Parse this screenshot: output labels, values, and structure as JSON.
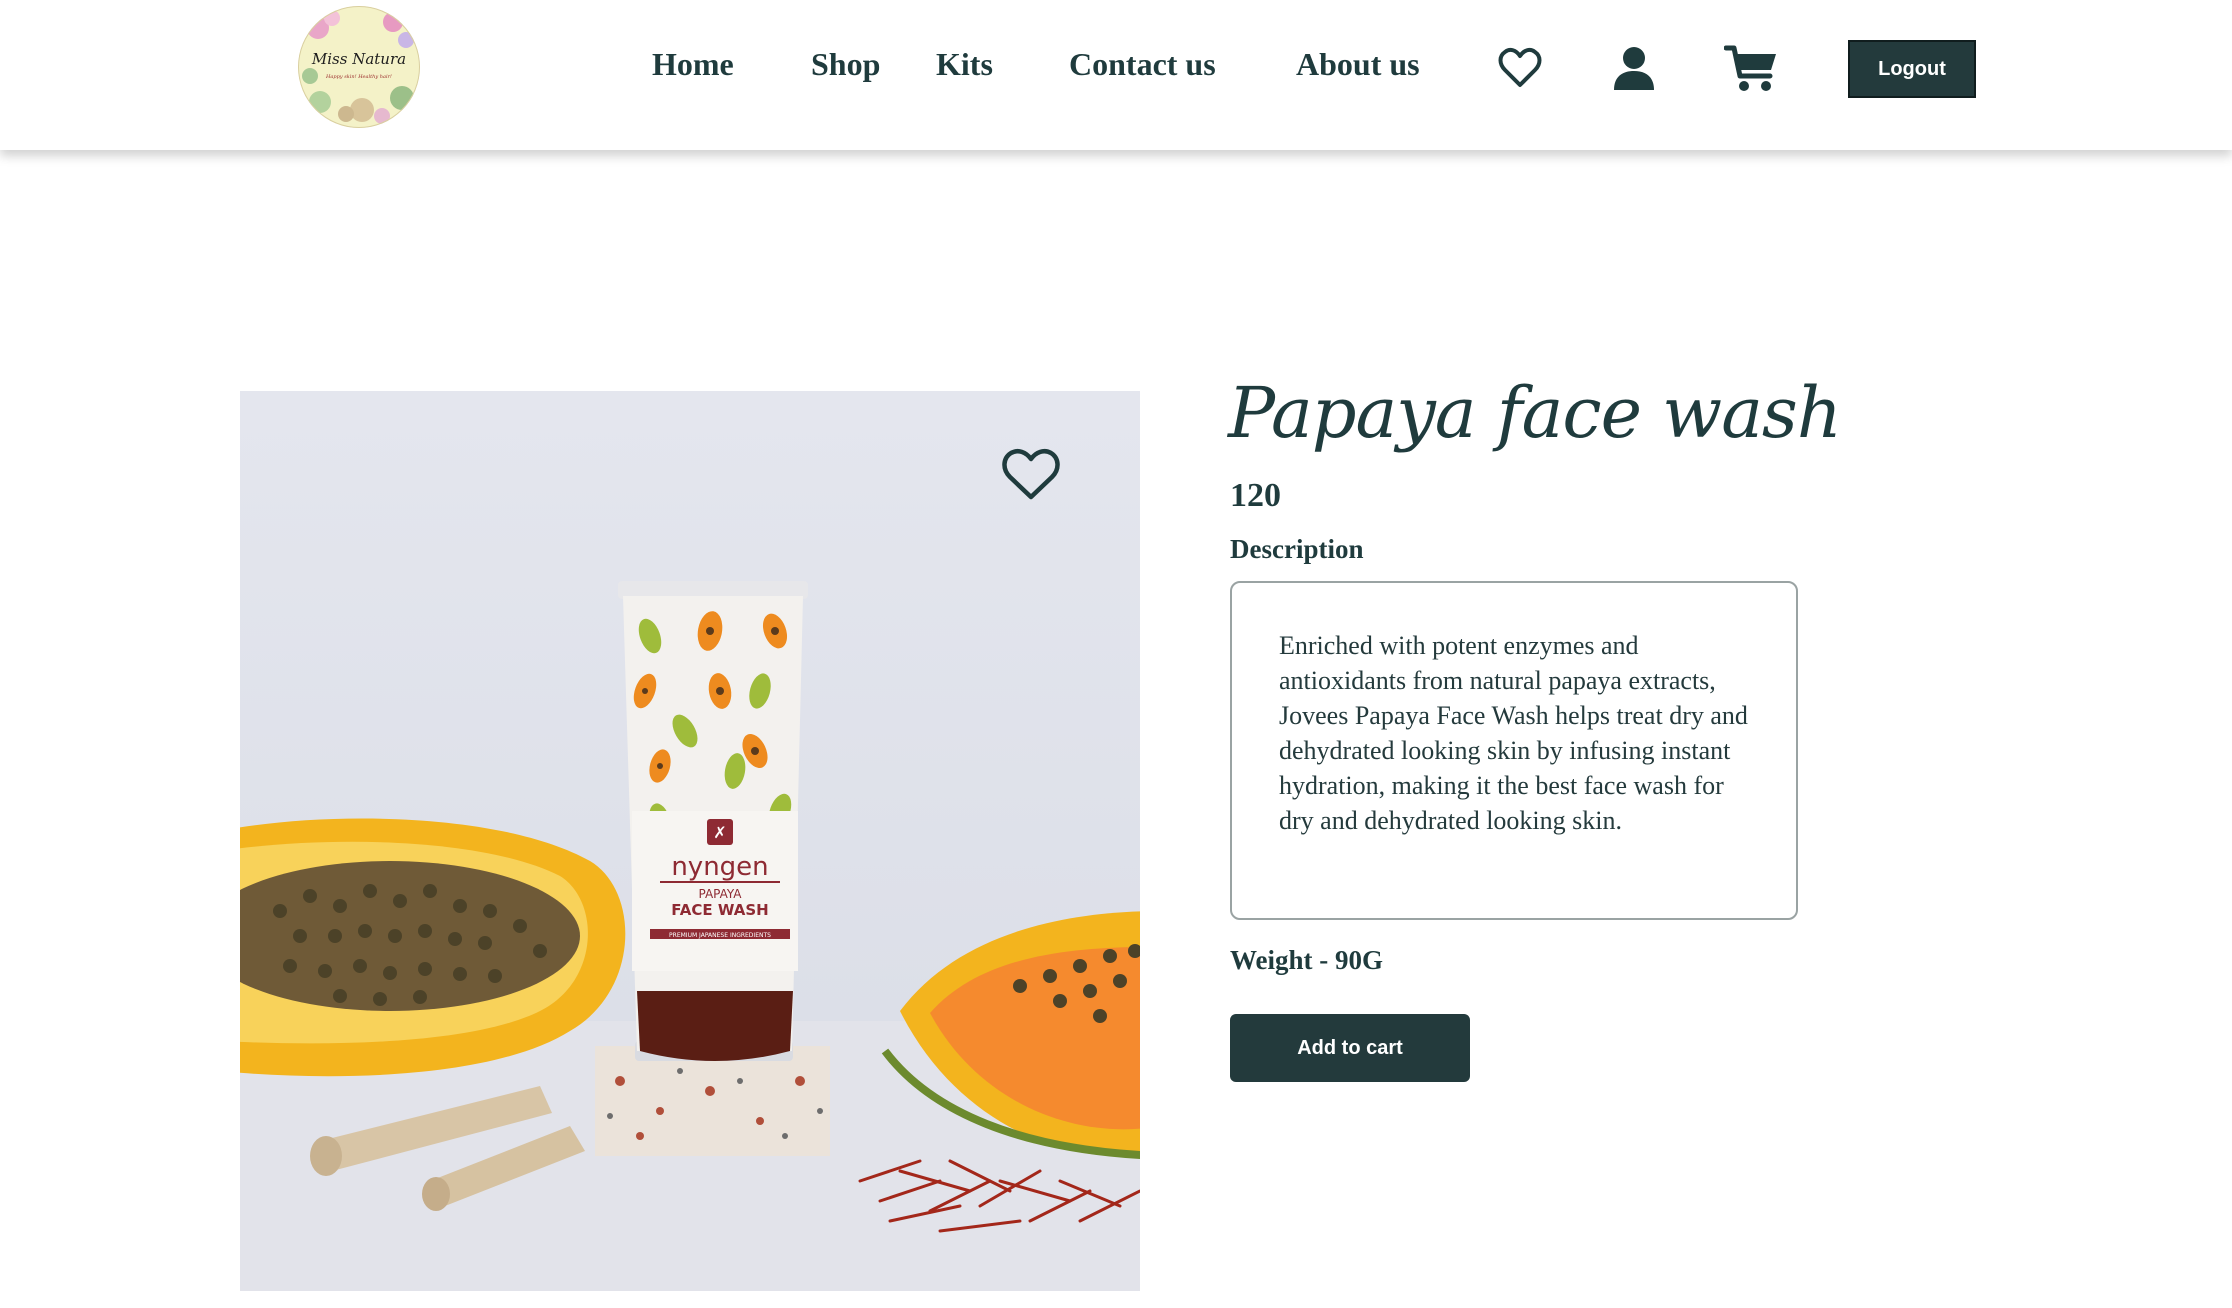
{
  "brand": {
    "logo_text": "Miss Natura",
    "logo_tagline": "Happy skin! Healthy hair!"
  },
  "nav": {
    "home": "Home",
    "shop": "Shop",
    "kits": "Kits",
    "contact": "Contact us",
    "about": "About us",
    "icons": [
      "heart-icon",
      "user-icon",
      "cart-icon"
    ],
    "logout": "Logout"
  },
  "product": {
    "name": "Papaya face wash",
    "price": "120",
    "description_label": "Description",
    "description": "Enriched with potent enzymes and antioxidants from natural papaya extracts, Jovees Papaya Face Wash helps treat dry and dehydrated looking skin by infusing instant hydration, making it the best face wash for dry and dehydrated looking skin.",
    "weight": "Weight - 90G",
    "add_to_cart": "Add to cart",
    "image": {
      "brand": "nyngen",
      "line1": "PAPAYA",
      "line2": "FACE WASH",
      "line3": "PREMIUM JAPANESE INGREDIENTS"
    }
  },
  "colors": {
    "primary": "#233a3c",
    "text": "#1f3b3d",
    "background": "#ffffff"
  }
}
